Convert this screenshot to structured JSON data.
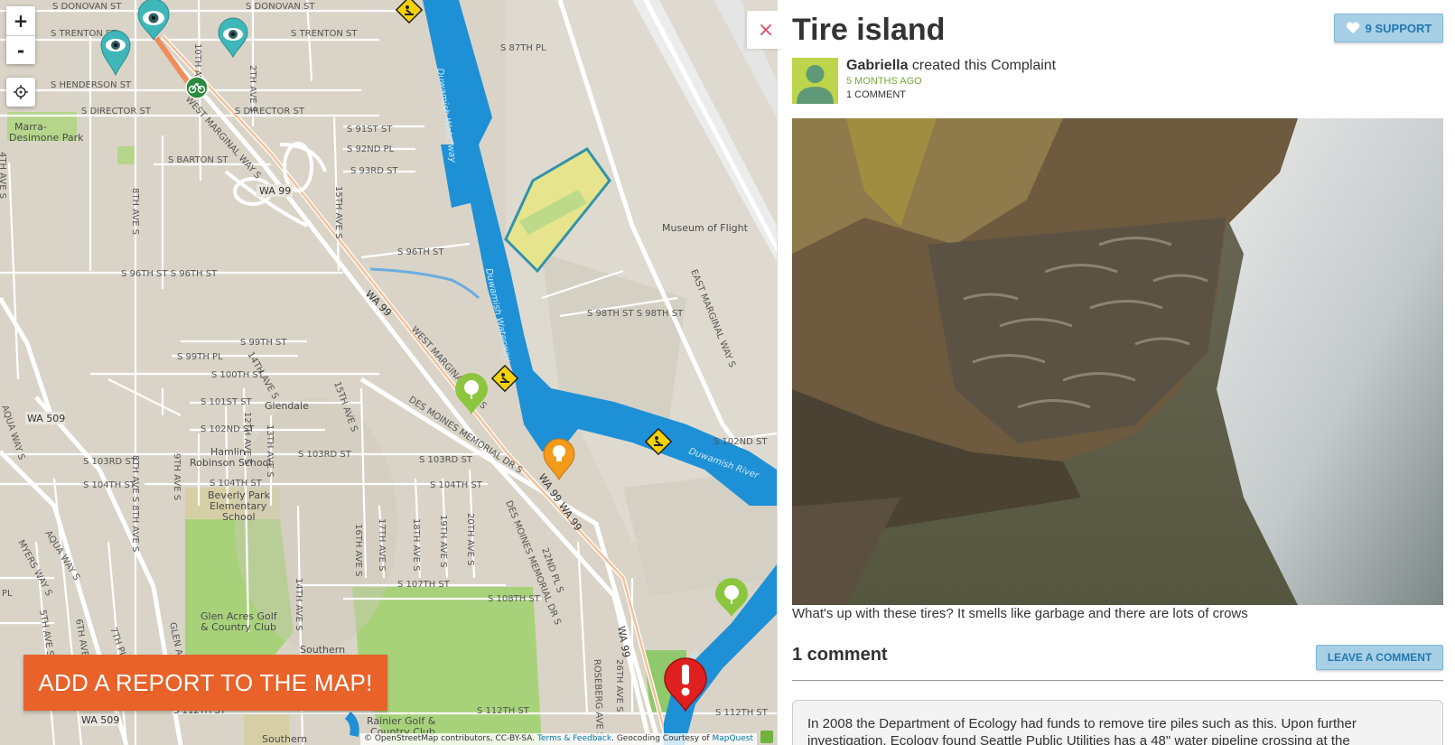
{
  "map": {
    "zoom_in_label": "+",
    "zoom_out_label": "-",
    "add_report_label": "ADD A REPORT TO THE MAP!",
    "attribution": {
      "prefix": "© OpenStreetMap contributors, CC-BY-SA. ",
      "terms_link": "Terms & Feedback",
      "middle": ". Geocoding Courtesy of ",
      "mapquest_link": "MapQuest"
    },
    "places": {
      "marra": "Marra-",
      "marra2": "Desimone Park",
      "museum": "Museum of Flight",
      "glendale": "Glendale",
      "hamlin1": "Hamlin",
      "hamlin2": "Robinson School",
      "beverly1": "Beverly Park",
      "beverly2": "Elementary",
      "beverly3": "School",
      "glenacres1": "Glen Acres Golf",
      "glenacres2": "& Country Club",
      "southern": "Southern",
      "rainier1": "Rainier Golf &",
      "rainier2": "Country Club",
      "southern2": "Southern"
    },
    "water": {
      "duwamish1": "Duwamish Waterway",
      "duwamish2": "Duwamish Waterway",
      "duwamish_river": "Duwamish River",
      "river2": "River"
    },
    "routes": {
      "wa99a": "WA 99",
      "wa99b": "WA 99",
      "wa99c": "WA 99 WA 99",
      "wa99d": "WA 99",
      "wa509a": "WA 509",
      "wa509b": "WA 509"
    },
    "streets": {
      "donovan1": "S DONOVAN ST",
      "donovan2": "S DONOVAN ST",
      "trenton1": "S TRENTON ST",
      "trenton2": "S TRENTON ST",
      "henderson": "S HENDERSON ST",
      "director1": "S DIRECTOR ST",
      "director2": "S DIRECTOR ST",
      "barton": "S BARTON ST",
      "s87": "S 87TH PL",
      "s91": "S 91ST ST",
      "s92": "S 92ND PL",
      "s93": "S 93RD ST",
      "s96a": "S 96TH ST",
      "s96b": "S 96TH ST S 96TH ST",
      "s98": "S 98TH ST S 98TH ST",
      "s99a": "S 99TH ST",
      "s99b": "S 99TH PL",
      "s100": "S 100TH ST",
      "s101": "S 101ST ST",
      "s102a": "S 102ND ST",
      "s102b": "S 102ND ST",
      "s103a": "S 103RD ST",
      "s103b": "S 103RD ST",
      "s103c": "S 103RD ST",
      "s104a": "S 104TH ST",
      "s104b": "S 104TH ST",
      "s104c": "S 104TH ST",
      "s104d": "S 104TH ST",
      "s107": "S 107TH ST",
      "s108": "S 108TH ST",
      "s112a": "S 112TH ST",
      "s112b": "S 112TH ST",
      "s112c": "S 112TH ST",
      "wmarginal1": "WEST MARGINAL WAY S",
      "wmarginal2": "WEST MARGINAL WAY S",
      "emarginal": "EAST MARGINAL WAY S",
      "desmoines1": "DES MOINES MEMORIAL DR S",
      "desmoines2": "DES MOINES MEMORIAL DR S",
      "ave8a": "8TH AVE S",
      "ave8b": "8TH AVE S 8TH AVE S",
      "ave10": "10TH AVE S",
      "ave12": "12TH AVE S",
      "ave13": "13TH AVE S",
      "ave14": "14TH AVE S",
      "ave14b": "14TH AVE S",
      "ave15": "15TH AVE S",
      "ave15b": "15TH AVE S",
      "ave16": "16TH AVE S",
      "ave17": "17TH AVE S",
      "ave18": "18TH AVE S",
      "ave19": "19TH AVE S",
      "ave20": "20TH AVE S",
      "ave22": "22ND PL S",
      "ave26": "26TH AVE S",
      "ave9": "9TH AVE S",
      "ave6": "6TH AVE S",
      "ave7": "7TH PL",
      "ave4": "4TH AVE S",
      "ave5": "5TH AVE S",
      "ave2": "2TH AVE S",
      "myers": "MYERS WAY S",
      "aqua1": "AQUA WAY S",
      "aqua2": "AQUA WAY S",
      "glenacres": "GLEN ACRES DR S",
      "roseberg": "ROSEBERG AVE S",
      "ninthave": "9TH AVE S",
      "myers2": "MYERS WAY S",
      "ave2b": "2TH AVE S",
      "pl": "PL",
      "ave6b": "6TH AVE S"
    }
  },
  "panel": {
    "close_label": "×",
    "title": "Tire island",
    "support_label": "9 SUPPORT",
    "author_name": "Gabriella",
    "author_action": " created this Complaint",
    "time_ago": "5 MONTHS AGO",
    "comment_count": "1 COMMENT",
    "caption": "What's up with these tires? It smells like garbage and there are lots of crows",
    "comments_heading": "1 comment",
    "leave_comment_label": "LEAVE A COMMENT",
    "comment_text": "In 2008 the Department of Ecology had funds to remove tire piles such as this. Upon further investigation, Ecology found Seattle Public Utilities has a 48\" water pipeline crossing at the"
  },
  "colors": {
    "water": "#1e90d6",
    "add_report": "#e8622a",
    "support_button": "#a7cfe6",
    "time_ago": "#7aa63c",
    "close": "#e0506b"
  }
}
